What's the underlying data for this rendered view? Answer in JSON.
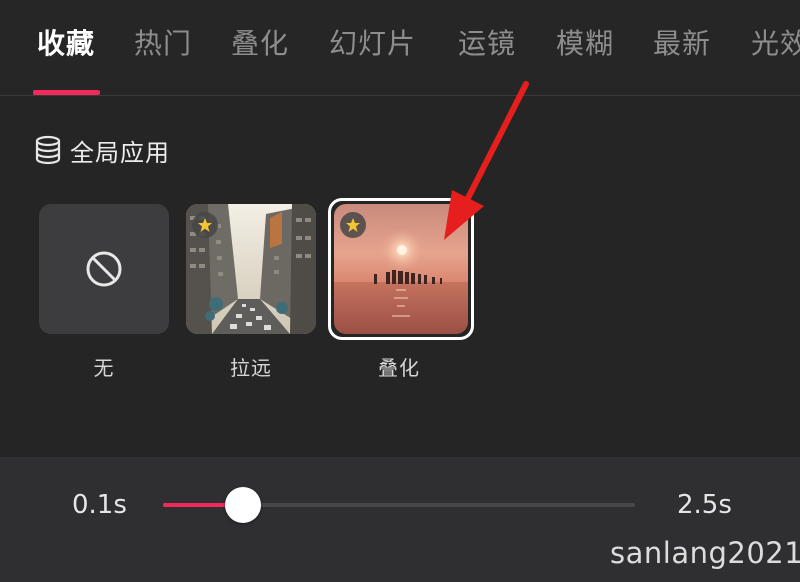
{
  "tabs": [
    {
      "label": "收藏",
      "active": true
    },
    {
      "label": "热门",
      "active": false
    },
    {
      "label": "叠化",
      "active": false
    },
    {
      "label": "幻灯片",
      "active": false
    },
    {
      "label": "运镜",
      "active": false
    },
    {
      "label": "模糊",
      "active": false
    },
    {
      "label": "最新",
      "active": false
    },
    {
      "label": "光效",
      "active": false
    }
  ],
  "global_apply": {
    "label": "全局应用",
    "icon": "database-icon"
  },
  "effects": [
    {
      "label": "无",
      "icon": "none-icon",
      "favorite": false,
      "selected": false
    },
    {
      "label": "拉远",
      "icon": "city-street-thumbnail",
      "favorite": true,
      "selected": false
    },
    {
      "label": "叠化",
      "icon": "sunset-sea-thumbnail",
      "favorite": true,
      "selected": true
    }
  ],
  "duration_slider": {
    "min_label": "0.1s",
    "max_label": "2.5s",
    "value_fraction": 0.17
  },
  "watermark": "sanlang2021",
  "colors": {
    "accent": "#f2295b",
    "background": "#252526",
    "panel": "#2f2f31",
    "arrow": "#e61e1e"
  }
}
